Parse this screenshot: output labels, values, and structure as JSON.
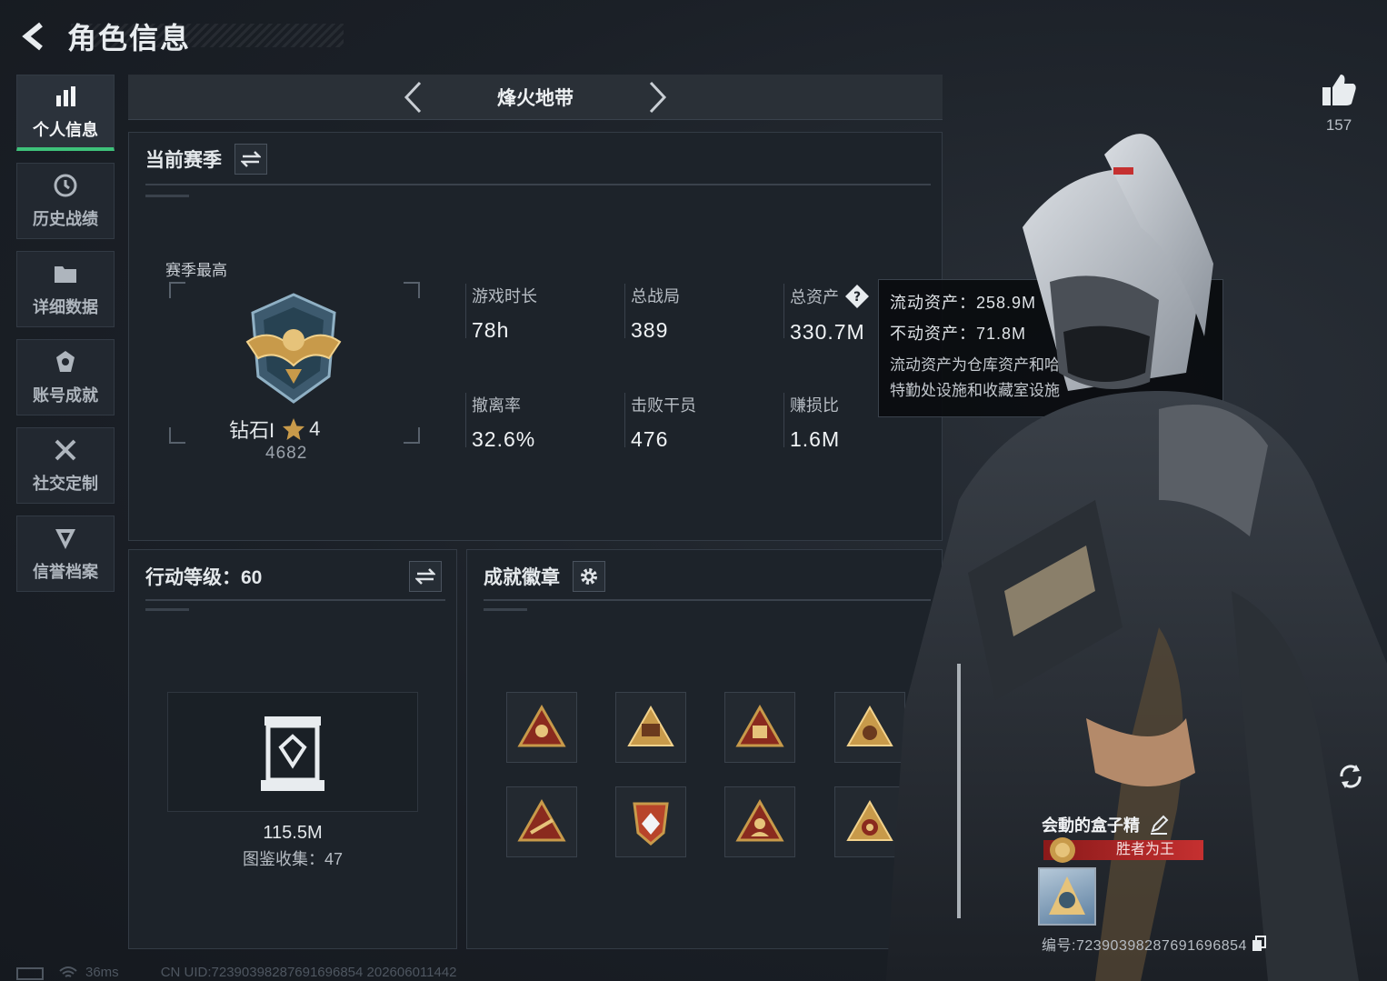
{
  "header": {
    "title": "角色信息"
  },
  "sidebar": {
    "items": [
      {
        "label": "个人信息",
        "icon": "bar-chart-icon",
        "active": true
      },
      {
        "label": "历史战绩",
        "icon": "history-icon"
      },
      {
        "label": "详细数据",
        "icon": "folder-icon"
      },
      {
        "label": "账号成就",
        "icon": "achievement-icon"
      },
      {
        "label": "社交定制",
        "icon": "tools-icon"
      },
      {
        "label": "信誉档案",
        "icon": "shield-icon"
      }
    ]
  },
  "mode": {
    "title": "烽火地带"
  },
  "season": {
    "title": "当前赛季",
    "best_label": "赛季最高",
    "rank_name": "钻石I",
    "rank_stars": "4",
    "rank_score": "4682",
    "stats": [
      {
        "label": "游戏时长",
        "value": "78h"
      },
      {
        "label": "总战局",
        "value": "389"
      },
      {
        "label": "总资产",
        "value": "330.7M"
      },
      {
        "label": "撤离率",
        "value": "32.6%"
      },
      {
        "label": "击败干员",
        "value": "476"
      },
      {
        "label": "赚损比",
        "value": "1.6M"
      }
    ]
  },
  "tooltip": {
    "liquid": "流动资产：258.9M",
    "fixed": "不动资产：71.8M",
    "note_line1": "流动资产为仓库资产和哈夫币，不动资产为",
    "note_line2": "特勤处设施和收藏室设施"
  },
  "action_level": {
    "title": "行动等级：60",
    "collection_value": "115.5M",
    "collection_label": "图鉴收集：47"
  },
  "achievements": {
    "title": "成就徽章",
    "badges": [
      "badge-1",
      "badge-2",
      "badge-3",
      "badge-4",
      "badge-5",
      "badge-6",
      "badge-7",
      "badge-8"
    ]
  },
  "likes": {
    "count": "157"
  },
  "profile": {
    "name": "会動的盒子精",
    "title": "胜者为王",
    "id_line": "编号:723903982876916968​54"
  },
  "statusbar": {
    "ping": "36ms",
    "uid": "CN UID:723903982876916968​54 202606011442"
  },
  "colors": {
    "accent_green": "#3ec27a",
    "title_red": "#c53030",
    "badge_gold": "#c89a4a"
  }
}
